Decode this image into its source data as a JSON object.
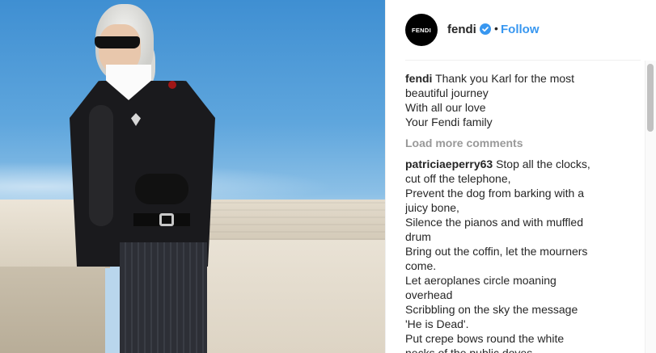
{
  "post": {
    "account": {
      "username": "fendi",
      "avatar_text": "FENDI",
      "verified": true,
      "follow_label": "Follow",
      "separator": "•"
    },
    "caption": {
      "user": "fendi",
      "lines": [
        "Thank you Karl for the most",
        "beautiful journey",
        "With all our love",
        "Your Fendi family"
      ]
    },
    "load_more_label": "Load more comments",
    "comments": [
      {
        "user": "patriciaeperry63",
        "lines": [
          "Stop all the clocks,",
          "cut off the telephone,",
          "Prevent the dog from barking with a",
          "juicy bone,",
          "Silence the pianos and with muffled",
          "drum",
          "Bring out the coffin, let the mourners",
          "come.",
          "Let aeroplanes circle moaning",
          "overhead",
          "Scribbling on the sky the message",
          "'He is Dead'.",
          "Put crepe bows round the white",
          "necks of the public doves,"
        ]
      }
    ]
  },
  "colors": {
    "follow": "#3897f0",
    "verified": "#3897f0",
    "muted": "#999999",
    "text": "#262626"
  },
  "icons": {
    "verified": "verified-badge-icon"
  }
}
